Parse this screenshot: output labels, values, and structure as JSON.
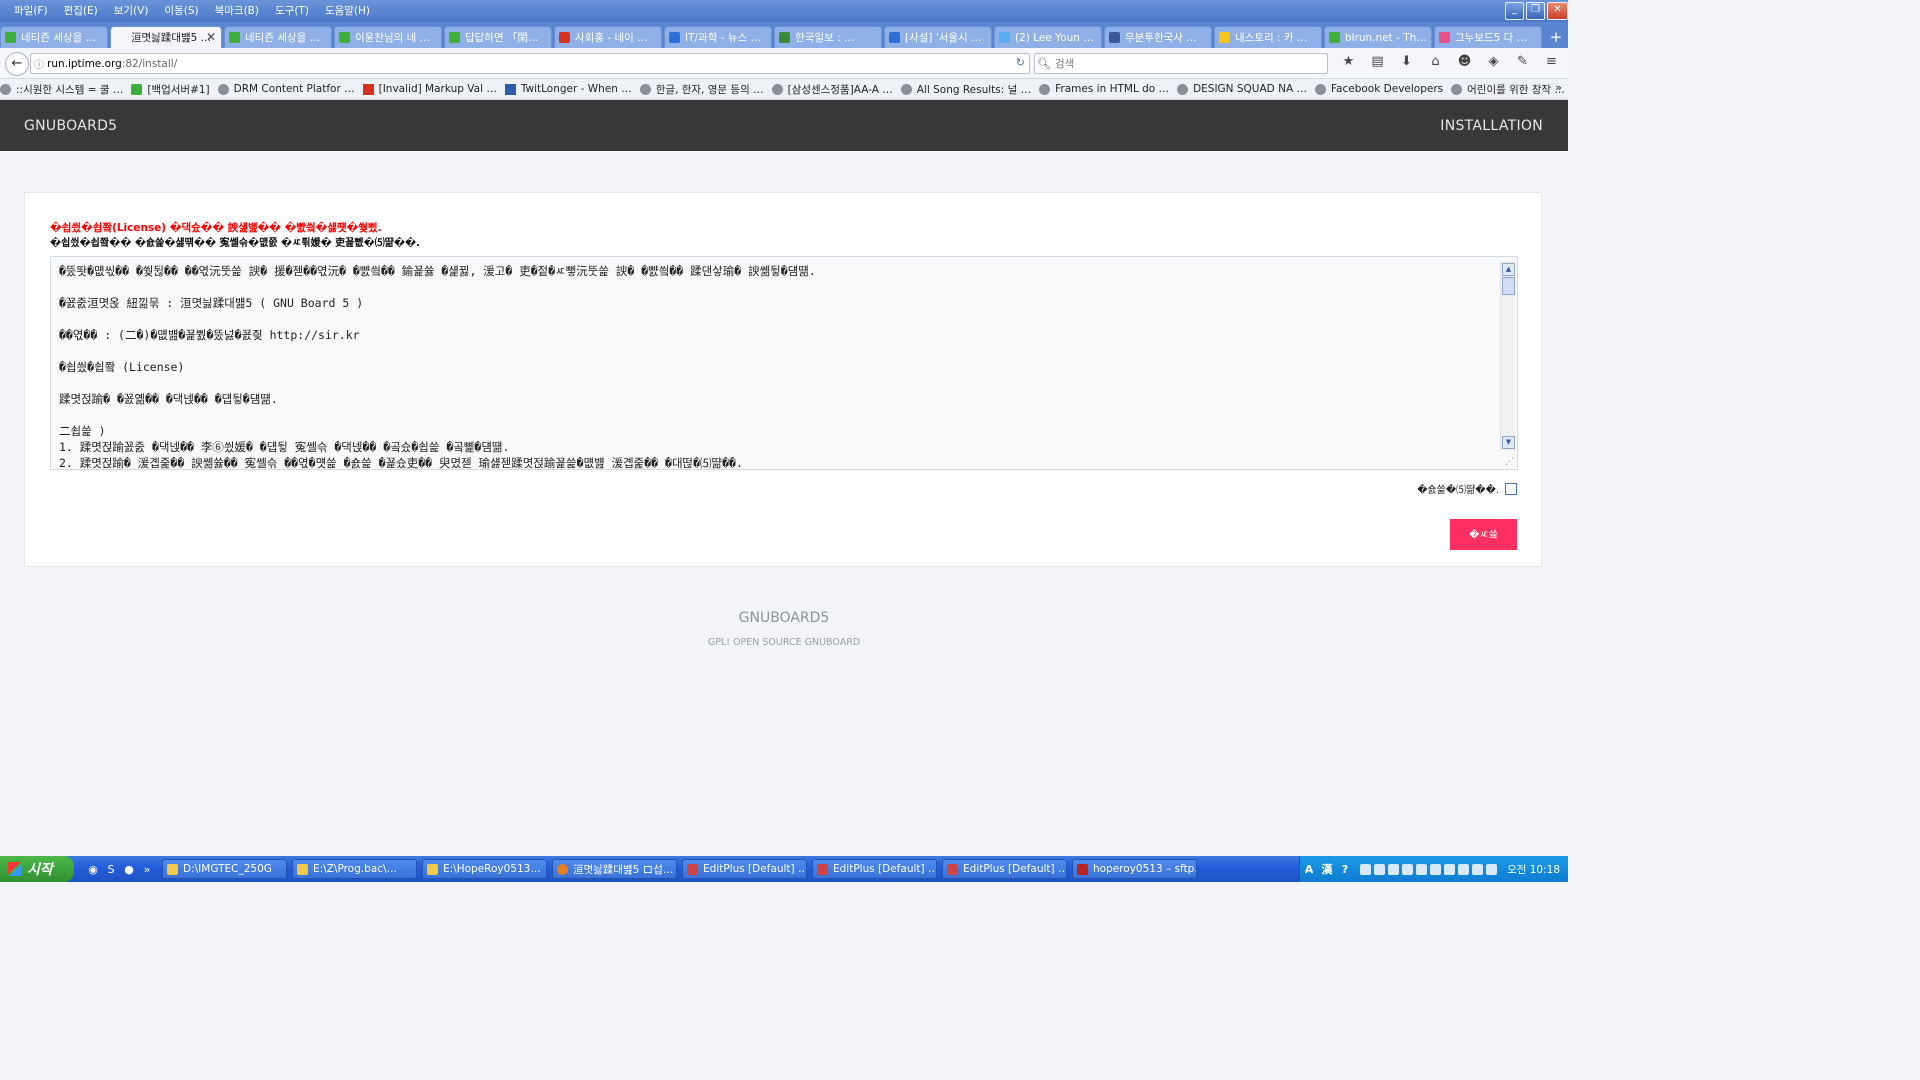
{
  "menubar": {
    "menus": [
      "파일(F)",
      "편집(E)",
      "보기(V)",
      "이동(S)",
      "북마크(B)",
      "도구(T)",
      "도움말(H)"
    ],
    "window_buttons": [
      "_",
      "❐",
      "✕"
    ]
  },
  "tabs": [
    {
      "label": "네티즌 세상을 …",
      "favicon_color": "#3fae3a"
    },
    {
      "label": "洹몃늻蹂대뱶5 …",
      "favicon_color": "",
      "active": true
    },
    {
      "label": "네티즌 세상을 …",
      "favicon_color": "#3fae3a"
    },
    {
      "label": "이윤찬님의 네 …",
      "favicon_color": "#3fae3a"
    },
    {
      "label": "답답하면 「閑…",
      "favicon_color": "#3fae3a"
    },
    {
      "label": "사회홍 - 네이 …",
      "favicon_color": "#d6311f"
    },
    {
      "label": "IT/과학 - 뉴스 …",
      "favicon_color": "#2d6fd6"
    },
    {
      "label": "한국일보 : …",
      "favicon_color": "#3a8a3a"
    },
    {
      "label": "[사설] '서울시 …",
      "favicon_color": "#2d6fd6"
    },
    {
      "label": "(2) Lee Youn …",
      "favicon_color": "#55acee"
    },
    {
      "label": "우분투한국사 …",
      "favicon_color": "#3b5998"
    },
    {
      "label": "내스토리 : 카 …",
      "favicon_color": "#f5c518"
    },
    {
      "label": "blrun.net - Th…",
      "favicon_color": "#3fae3a"
    },
    {
      "label": "그누보드5 다 …",
      "favicon_color": "#e8508a"
    }
  ],
  "tab_close": "✕",
  "newtab": "+",
  "nav": {
    "back": "←",
    "url_host": "run.iptime.org",
    "url_rest": ":82/install/",
    "url_prefix": "",
    "reload": "↻",
    "search_placeholder": "검색",
    "icons": [
      "★",
      "▤",
      "⬇",
      "⌂",
      "☻",
      "◈",
      "✎",
      "≡"
    ]
  },
  "bookmarks": [
    {
      "label": "::시원한 시스템 = 쿨 …",
      "icon": "globe"
    },
    {
      "label": "[백업서버#1]",
      "icon": "green"
    },
    {
      "label": "DRM Content Platfor …",
      "icon": "globe"
    },
    {
      "label": "[Invalid] Markup Val …",
      "icon": "red"
    },
    {
      "label": "TwitLonger - When …",
      "icon": "blue"
    },
    {
      "label": "한글, 한자, 영문 등의 …",
      "icon": "globe"
    },
    {
      "label": "[삼성센스정품]AA-A …",
      "icon": "globe"
    },
    {
      "label": "All Song Results: 널 …",
      "icon": "globe"
    },
    {
      "label": "Frames in HTML do …",
      "icon": "globe"
    },
    {
      "label": "DESIGN SQUAD NA …",
      "icon": "globe"
    },
    {
      "label": "Facebook Developers",
      "icon": "globe"
    },
    {
      "label": "어린이를 위한 창작 …",
      "icon": "globe"
    }
  ],
  "bookmarks_more": "»",
  "page": {
    "logo": "GNUBOARD5",
    "installation": "INSTALLATION",
    "license_title": "�쇱씠�쇱쫰(License) �댁슜�� 諛섎뱶�� �뺤씤�섏떗�쒖삤.",
    "license_sub": "�쇱씠�쇱쫰�� �숈쓽�섏떆�� 寃쎌슦�먮쭔 �ㅼ튂媛� 吏꾪뻾�⑸땲��.",
    "license_lines": [
      "�뚰똿�먮씫�� �쒖뒪�� ��엯沅뚯쓽 諛� 援�젣��엯沅� �뺤씤�� 鍮꾩쓣 �섍뀛, 湲고� 吏�젙�ㅼ뼇沅뚯쓽 諛� �뺤씤�� 蹂댄샇瑜� 諛쏆뒿�덈떎.",
      "",
      "�꾨줈洹몃옩 紐낆묶 : 洹몃늻蹂대뱶5 ( GNU Board 5 )",
      "",
      "��엯�� : (二�)�먮뱶�꾩뿴�뚰넗�꾨즺 http://sir.kr",
      "",
      "�쇱씠�쇱쫰 (License)",
      "",
      "蹂몃젅踰� �꾨옒�� �댁넩�� �덉뒿�덈떎.",
      "",
      "二쇱쓽 )",
      "1. 蹂몃젅踰꾨줈 �댁넩�� 李⑥씠媛� �덉뒿 寃쎌슦 �댁넩�� �곸슜�쇱쓽 �곸뼱�덈떎.",
      "2. 蹂몃젅踰� 湲곕줉�� 諛쏆쓣�� 寃쎌슦 ��엯�먯쓽 �숈쓽 �꾩슜吏�� 臾몄젣 瑜섏젣蹂몃젅踰꾩쓽�먮뱶 湲곕줉�� �대떦�⑸땲��."
    ],
    "agree_label": "�숈쓽�⑸땲��.",
    "next_button": "�ㅼ쓬",
    "footer_title": "GNUBOARD5",
    "footer_sub": "GPL! OPEN SOURCE GNUBOARD"
  },
  "taskbar": {
    "start": "시작",
    "quick": [
      "◉",
      "S",
      "●",
      "»"
    ],
    "tasks": [
      {
        "label": "D:\\IMGTEC_250G",
        "icon": "folder"
      },
      {
        "label": "E:\\Z\\Prog.bac\\…",
        "icon": "folder"
      },
      {
        "label": "E:\\HopeRoy0513…",
        "icon": "folder"
      },
      {
        "label": "洹몃늻蹂대뱶5 ロ섭…",
        "icon": "firefox"
      },
      {
        "label": "EditPlus [Default] …",
        "icon": "editplus"
      },
      {
        "label": "EditPlus [Default] …",
        "icon": "editplus"
      },
      {
        "label": "EditPlus [Default] …",
        "icon": "editplus"
      },
      {
        "label": "hoperoy0513 – sftp…",
        "icon": "filezilla"
      }
    ],
    "ime": [
      "A",
      "漢",
      "?"
    ],
    "clock": "오전 10:18"
  }
}
